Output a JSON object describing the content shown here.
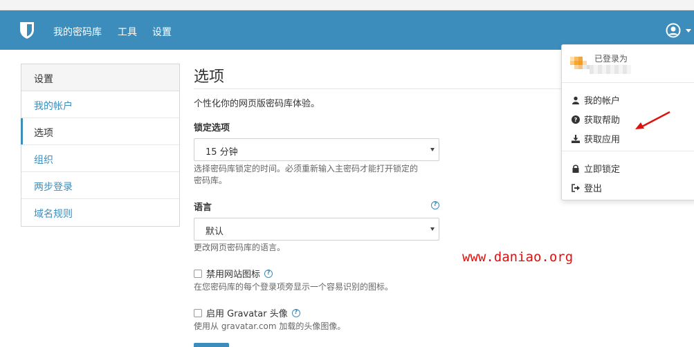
{
  "navbar": {
    "links": [
      "我的密码库",
      "工具",
      "设置"
    ]
  },
  "sidebar": {
    "title": "设置",
    "items": [
      {
        "label": "我的帐户",
        "active": false
      },
      {
        "label": "选项",
        "active": true
      },
      {
        "label": "组织",
        "active": false
      },
      {
        "label": "两步登录",
        "active": false
      },
      {
        "label": "域名规则",
        "active": false
      }
    ]
  },
  "main": {
    "title": "选项",
    "intro": "个性化你的网页版密码库体验。",
    "lock": {
      "label": "锁定选项",
      "value": "15 分钟",
      "help_line1": "选择密码库锁定的时间。必须重新输入主密码才能打开锁定的",
      "help_line2": "密码库。"
    },
    "language": {
      "label": "语言",
      "value": "默认",
      "help": "更改网页密码库的语言。"
    },
    "disable_favicons": {
      "label": "禁用网站图标",
      "checked": false,
      "help": "在您密码库的每个登录项旁显示一个容易识别的图标。"
    },
    "gravatar": {
      "label": "启用 Gravatar 头像",
      "checked": false,
      "help": "使用从 gravatar.com 加载的头像图像。"
    }
  },
  "user_dropdown": {
    "status": "已登录为",
    "items": [
      {
        "label": "我的帐户",
        "icon": "user-icon"
      },
      {
        "label": "获取帮助",
        "icon": "question-circle-icon"
      },
      {
        "label": "获取应用",
        "icon": "download-icon"
      },
      {
        "label": "立即锁定",
        "icon": "lock-icon"
      },
      {
        "label": "登出",
        "icon": "sign-out-icon"
      }
    ]
  },
  "watermark": "www.daniao.org",
  "colors": {
    "navbar": "#3c8dbc",
    "link": "#3c8dbc",
    "annotation_arrow": "#e0100f"
  }
}
